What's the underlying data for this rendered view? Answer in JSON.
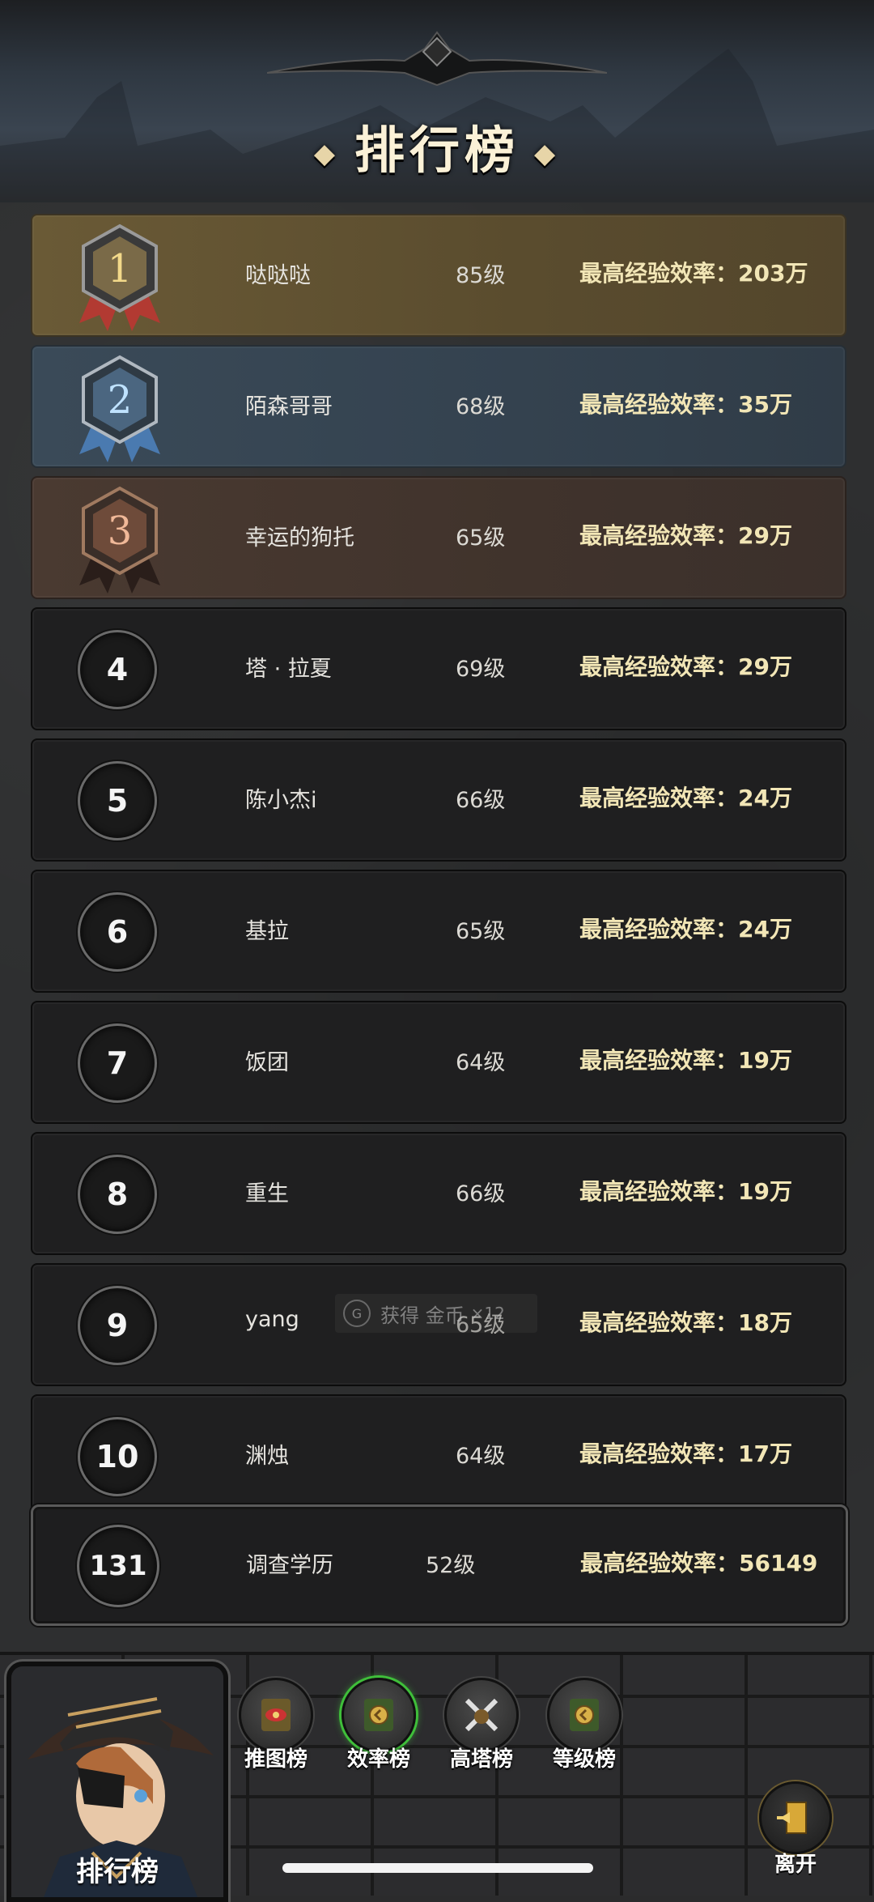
{
  "title": "排行榜",
  "top_ranks": [
    {
      "rank": "1",
      "name": "哒哒哒",
      "level": "85级",
      "efficiency": "最高经验效率：203万"
    },
    {
      "rank": "2",
      "name": "陌森哥哥",
      "level": "68级",
      "efficiency": "最高经验效率：35万"
    },
    {
      "rank": "3",
      "name": "幸运的狗托",
      "level": "65级",
      "efficiency": "最高经验效率：29万"
    }
  ],
  "ranks": [
    {
      "rank": "4",
      "name": "塔 · 拉夏",
      "level": "69级",
      "efficiency": "最高经验效率：29万"
    },
    {
      "rank": "5",
      "name": "陈小杰i",
      "level": "66级",
      "efficiency": "最高经验效率：24万"
    },
    {
      "rank": "6",
      "name": "基拉",
      "level": "65级",
      "efficiency": "最高经验效率：24万"
    },
    {
      "rank": "7",
      "name": "饭团",
      "level": "64级",
      "efficiency": "最高经验效率：19万"
    },
    {
      "rank": "8",
      "name": "重生",
      "level": "66级",
      "efficiency": "最高经验效率：19万"
    },
    {
      "rank": "9",
      "name": "yang",
      "level": "65级",
      "efficiency": "最高经验效率：18万"
    },
    {
      "rank": "10",
      "name": "渊烛",
      "level": "64级",
      "efficiency": "最高经验效率：17万"
    }
  ],
  "my_rank": {
    "rank": "131",
    "name": "调查学历",
    "level": "52级",
    "efficiency": "最高经验效率：56149"
  },
  "toast": {
    "text": "获得 金币",
    "multiplier": "×12",
    "icon": "G"
  },
  "portrait_label": "排行榜",
  "tabs": [
    {
      "label": "推图榜",
      "icon": "eye-scroll-icon"
    },
    {
      "label": "效率榜",
      "icon": "clock-scroll-icon",
      "active": true
    },
    {
      "label": "高塔榜",
      "icon": "crossed-swords-icon"
    },
    {
      "label": "等级榜",
      "icon": "clock-scroll-icon"
    }
  ],
  "leave_label": "离开",
  "colors": {
    "gold": "#6a5a36",
    "silver": "#3a4a58",
    "bronze": "#4a3a31",
    "efficiency_text": "#f2e6b6",
    "active_tab": "#3fbf3a"
  }
}
